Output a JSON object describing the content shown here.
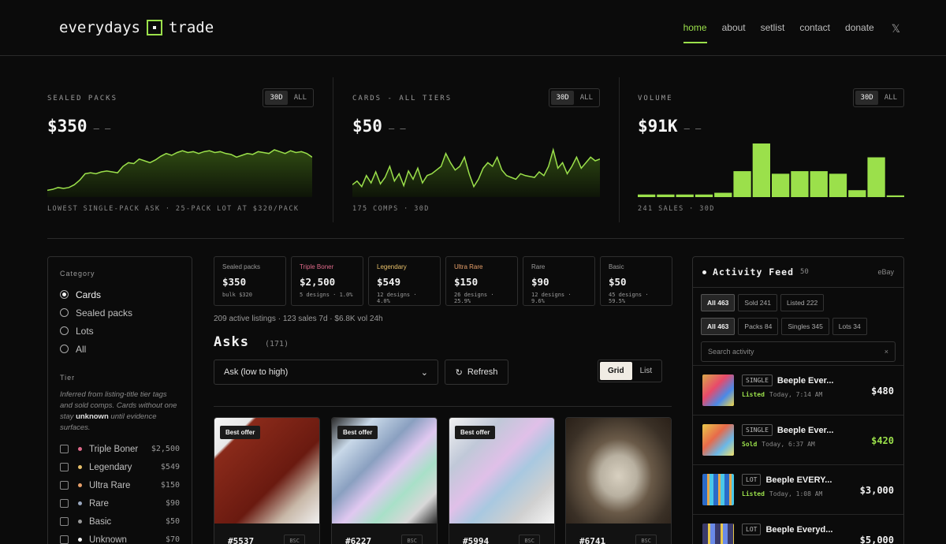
{
  "brand": {
    "left": "everydays",
    "right": "trade"
  },
  "nav": {
    "items": [
      "home",
      "about",
      "setlist",
      "contact",
      "donate"
    ],
    "active": "home"
  },
  "stats": [
    {
      "title": "SEALED PACKS",
      "seg": [
        "30D",
        "ALL"
      ],
      "value": "$350",
      "delta": "– –",
      "foot": "LOWEST SINGLE-PACK ASK · 25-PACK LOT AT $320/PACK",
      "spark": [
        4,
        5,
        7,
        6,
        7,
        10,
        15,
        22,
        23,
        22,
        24,
        25,
        24,
        23,
        30,
        34,
        33,
        38,
        36,
        34,
        37,
        41,
        44,
        42,
        45,
        47,
        45,
        46,
        44,
        46,
        47,
        45,
        46,
        44,
        43,
        40,
        42,
        44,
        43,
        46,
        45,
        44,
        48,
        46,
        44,
        47,
        45,
        46,
        44,
        40
      ]
    },
    {
      "title": "CARDS - ALL TIERS",
      "seg": [
        "30D",
        "ALL"
      ],
      "value": "$50",
      "delta": "– –",
      "foot": "175 COMPS · 30D",
      "spark": [
        10,
        14,
        8,
        20,
        12,
        24,
        11,
        18,
        30,
        14,
        22,
        9,
        25,
        16,
        28,
        12,
        20,
        22,
        26,
        30,
        44,
        34,
        26,
        30,
        40,
        22,
        8,
        16,
        28,
        34,
        30,
        40,
        26,
        20,
        18,
        16,
        22,
        20,
        19,
        18,
        24,
        20,
        30,
        48,
        28,
        34,
        22,
        30,
        40,
        28,
        34,
        40,
        36,
        38
      ]
    },
    {
      "title": "VOLUME",
      "seg": [
        "30D",
        "ALL"
      ],
      "value": "$91K",
      "delta": "– –",
      "foot": "241 SALES · 30D",
      "bars": [
        3,
        3,
        3,
        3,
        5,
        30,
        62,
        27,
        30,
        30,
        27,
        8,
        46,
        2
      ]
    }
  ],
  "sidebar": {
    "category_label": "Category",
    "categories": [
      {
        "label": "Cards",
        "selected": true
      },
      {
        "label": "Sealed packs",
        "selected": false
      },
      {
        "label": "Lots",
        "selected": false
      },
      {
        "label": "All",
        "selected": false
      }
    ],
    "tier_label": "Tier",
    "tier_note_a": "Inferred from listing-title tier tags and sold comps. Cards without one stay ",
    "tier_note_b": "unknown",
    "tier_note_c": " until evidence surfaces.",
    "tiers": [
      {
        "name": "Triple Boner",
        "price": "$2,500",
        "color": "#e06a8a"
      },
      {
        "name": "Legendary",
        "price": "$549",
        "color": "#e8c06a"
      },
      {
        "name": "Ultra Rare",
        "price": "$150",
        "color": "#e8a06a"
      },
      {
        "name": "Rare",
        "price": "$90",
        "color": "#9aa8c0"
      },
      {
        "name": "Basic",
        "price": "$50",
        "color": "#9a9a9a"
      },
      {
        "name": "Unknown",
        "price": "$70",
        "color": "#f2f2f2"
      }
    ]
  },
  "tier_cards": [
    {
      "name": "Sealed packs",
      "value": "$350",
      "sub": "bulk $320",
      "color": "#9a9a9a"
    },
    {
      "name": "Triple Boner",
      "value": "$2,500",
      "sub": "5 designs · 1.0%",
      "color": "#e06a8a"
    },
    {
      "name": "Legendary",
      "value": "$549",
      "sub": "12 designs · 4.0%",
      "color": "#e8c06a"
    },
    {
      "name": "Ultra Rare",
      "value": "$150",
      "sub": "26 designs · 25.9%",
      "color": "#e8a06a"
    },
    {
      "name": "Rare",
      "value": "$90",
      "sub": "12 designs · 9.6%",
      "color": "#9a9a9a"
    },
    {
      "name": "Basic",
      "value": "$50",
      "sub": "45 designs · 59.5%",
      "color": "#9a9a9a"
    }
  ],
  "summary": "209 active listings · 123 sales 7d · $6.8K vol 24h",
  "asks": {
    "title": "Asks",
    "count": "(171)",
    "sort": "Ask (low to high)",
    "refresh": "Refresh",
    "views": [
      "Grid",
      "List"
    ]
  },
  "listings": [
    {
      "badge": "Best offer",
      "num": "#5537",
      "tag": "BSC"
    },
    {
      "badge": "Best offer",
      "num": "#6227",
      "tag": "BSC"
    },
    {
      "badge": "Best offer",
      "num": "#5994",
      "tag": "BSC"
    },
    {
      "badge": "",
      "num": "#6741",
      "tag": "BSC"
    }
  ],
  "feed": {
    "title": "Activity Feed",
    "count": "50",
    "source": "eBay",
    "chips1": [
      "All 463",
      "Sold 241",
      "Listed 222"
    ],
    "chips2": [
      "All 463",
      "Packs 84",
      "Singles 345",
      "Lots 34"
    ],
    "search_placeholder": "Search activity",
    "items": [
      {
        "tag": "SINGLE",
        "name": "Beeple Ever...",
        "status": "Listed",
        "time": "Today, 7:14 AM",
        "price": "$480",
        "status_color": "#9be04b",
        "price_color": "#f2f2f2"
      },
      {
        "tag": "SINGLE",
        "name": "Beeple Ever...",
        "status": "Sold",
        "time": "Today, 6:37 AM",
        "price": "$420",
        "status_color": "#9be04b",
        "price_color": "#9be04b"
      },
      {
        "tag": "LOT",
        "name": "Beeple EVERY...",
        "status": "Listed",
        "time": "Today, 1:08 AM",
        "price": "$3,000",
        "status_color": "#9be04b",
        "price_color": "#f2f2f2"
      },
      {
        "tag": "LOT",
        "name": "Beeple Everyd...",
        "status": "",
        "time": "",
        "price": "$5,000",
        "status_color": "#9be04b",
        "price_color": "#f2f2f2"
      }
    ]
  },
  "colors": {
    "accent": "#9be04b",
    "bg": "#0b0b0b"
  }
}
